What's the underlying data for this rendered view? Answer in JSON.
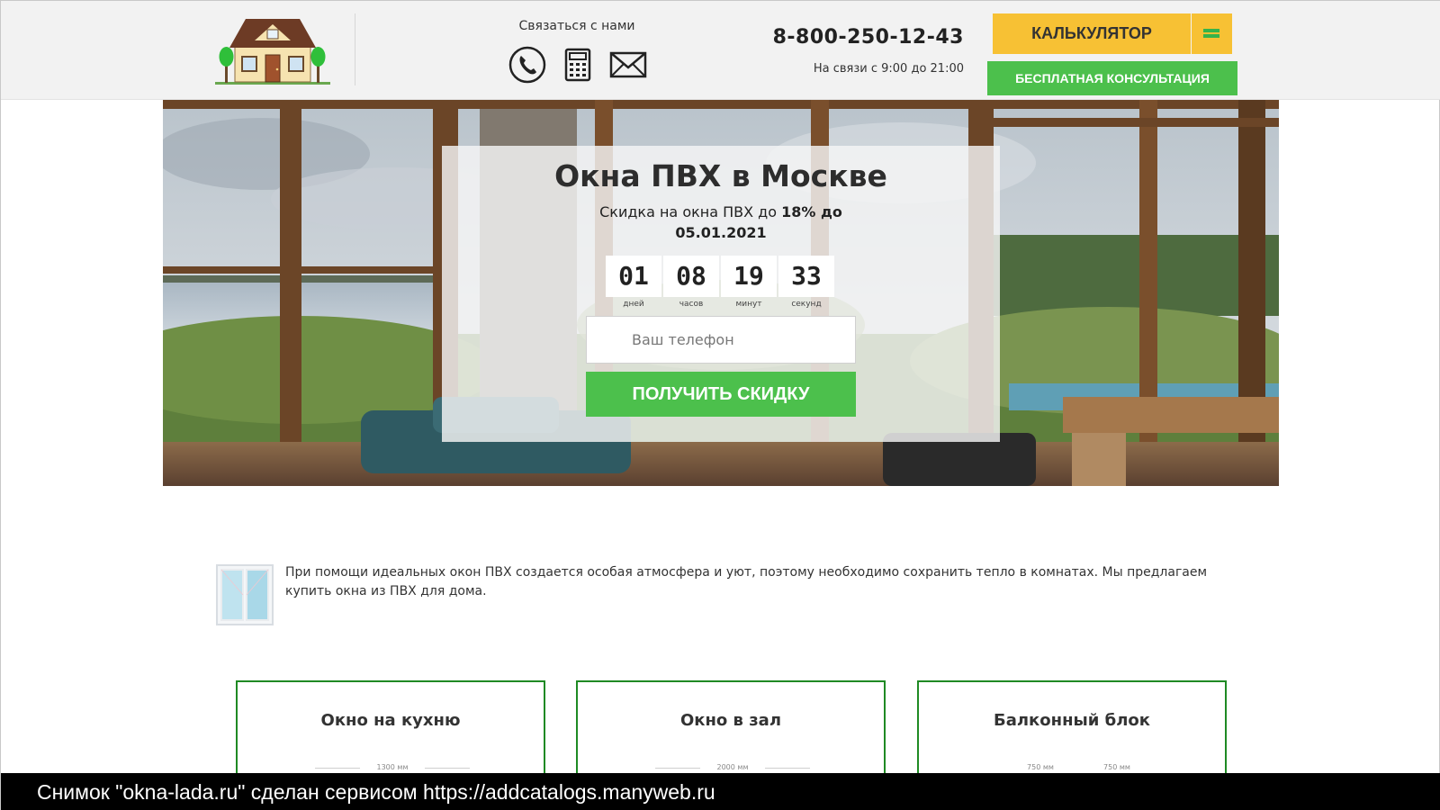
{
  "header": {
    "contact_title": "Связаться с нами",
    "contact_icons": [
      "phone-icon",
      "calculator-icon",
      "mail-icon"
    ],
    "phone": "8-800-250-12-43",
    "hours": "На связи с 9:00 до 21:00",
    "calc_label": "КАЛЬКУЛЯТОР",
    "consult_label": "БЕСПЛАТНАЯ КОНСУЛЬТАЦИЯ"
  },
  "hero": {
    "title": "Окна ПВХ в Москве",
    "subtitle_prefix": "Скидка на окна ПВХ до ",
    "subtitle_bold": "18% до 05.01.2021",
    "timer": [
      {
        "value": "01",
        "unit": "дней"
      },
      {
        "value": "08",
        "unit": "часов"
      },
      {
        "value": "19",
        "unit": "минут"
      },
      {
        "value": "33",
        "unit": "секунд"
      }
    ],
    "phone_placeholder": "Ваш телефон",
    "submit_label": "ПОЛУЧИТЬ СКИДКУ"
  },
  "intro": {
    "text": "При помощи идеальных окон ПВХ создается особая атмосфера и уют, поэтому необходимо сохранить тепло в комнатах. Мы предлагаем купить окна из ПВХ для дома."
  },
  "cards": [
    {
      "title": "Окно на кухню",
      "dims": [
        "1300 мм"
      ]
    },
    {
      "title": "Окно в зал",
      "dims": [
        "2000 мм"
      ]
    },
    {
      "title": "Балконный блок",
      "dims": [
        "750 мм",
        "750 мм"
      ]
    }
  ],
  "watermark": "Снимок \"okna-lada.ru\" сделан сервисом https://addcatalogs.manyweb.ru",
  "colors": {
    "accent_green": "#4cc04c",
    "accent_yellow": "#f7c134",
    "card_border": "#1f8a24"
  }
}
